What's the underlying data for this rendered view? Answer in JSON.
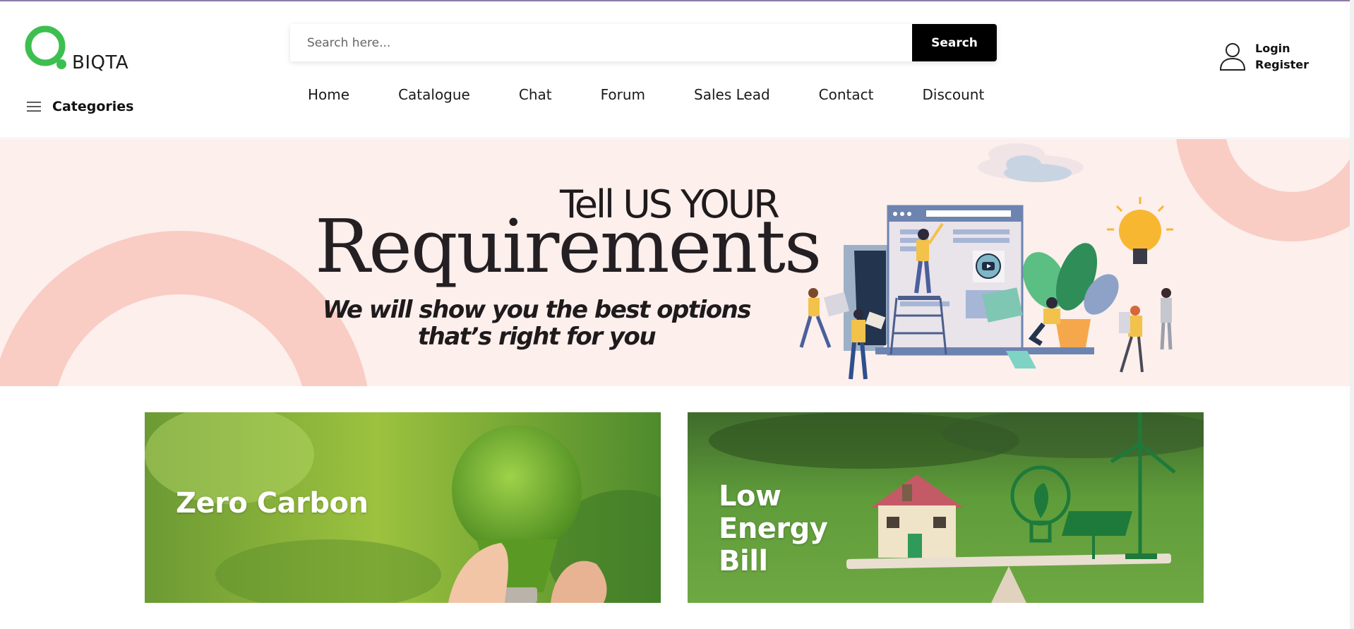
{
  "brand": {
    "name": "BIQTA",
    "accent": "#3dbf4f"
  },
  "categories": {
    "label": "Categories"
  },
  "search": {
    "placeholder": "Search here...",
    "button_label": "Search"
  },
  "nav": [
    "Home",
    "Catalogue",
    "Chat",
    "Forum",
    "Sales Lead",
    "Contact",
    "Discount"
  ],
  "account": {
    "login_label": "Login",
    "register_label": "Register"
  },
  "hero": {
    "line1": "Tell US YOUR",
    "line2": "Requirements",
    "line3": "We will show you the best  options that’s right for you",
    "background": "#fcefec",
    "accent": "#f9cfc6"
  },
  "promos": [
    {
      "label": "Zero Carbon"
    },
    {
      "label": "Low Energy Bill"
    }
  ],
  "icons": [
    "hamburger-menu-icon",
    "user-icon",
    "chevron-left-icon",
    "chevron-right-icon"
  ]
}
